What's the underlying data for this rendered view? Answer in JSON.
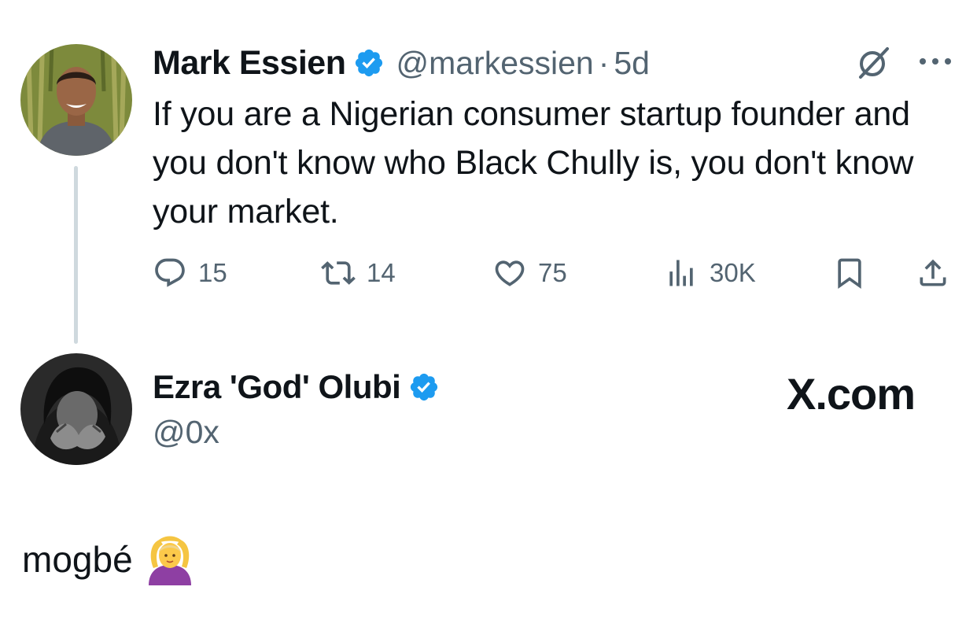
{
  "quoted_tweet": {
    "author_name": "Mark Essien",
    "author_handle": "@markessien",
    "separator": "·",
    "timestamp": "5d",
    "text": "If you are a Nigerian consumer startup founder and you don't know who Black Chully is, you don't know your market.",
    "actions": {
      "replies": "15",
      "retweets": "14",
      "likes": "75",
      "views": "30K"
    }
  },
  "main_tweet": {
    "author_name": "Ezra 'God' Olubi",
    "author_handle": "@0x",
    "source": "X.com",
    "reply_text": "mogbé"
  },
  "icons": {
    "verified": "verified-badge-icon",
    "grok": "grok-icon",
    "more": "more-icon",
    "reply": "reply-icon",
    "retweet": "retweet-icon",
    "like": "heart-icon",
    "views": "views-icon",
    "bookmark": "bookmark-icon",
    "share": "share-icon",
    "emoji": "person-gesturing-ok-emoji"
  },
  "colors": {
    "text": "#0f1419",
    "secondary": "#536471",
    "verified": "#1d9bf0",
    "thread_line": "#cfd9de"
  }
}
